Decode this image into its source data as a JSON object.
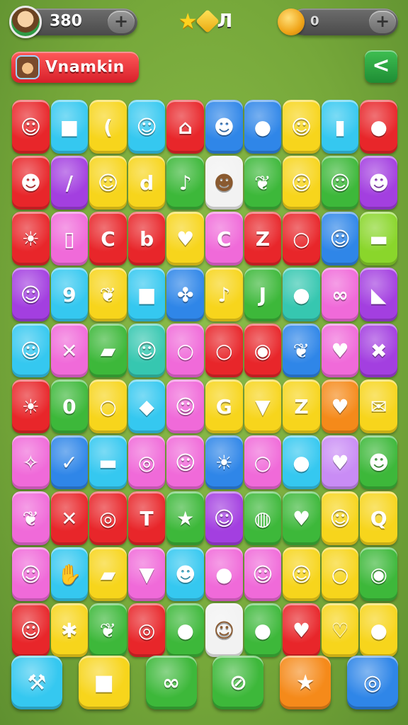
{
  "hud": {
    "coins": "380",
    "plus_label": "+",
    "gems": "0",
    "gem_plus_label": "+",
    "title_note": "Л"
  },
  "banner": {
    "label": "Vnamkin"
  },
  "back_label": "<",
  "colors": {
    "red": "#e8262a",
    "cyan": "#35c8f0",
    "yellow": "#f7d51c",
    "blue": "#2f86e8",
    "purple": "#a33fe0",
    "pink": "#f06ad9",
    "green": "#3db83a",
    "lime": "#8ad62b",
    "orange": "#f58a1a",
    "white": "#f2f2f2",
    "violet": "#c98cf5",
    "teal": "#36c7b0"
  },
  "board": {
    "rows": [
      [
        {
          "c": "red",
          "i": "gnome-icon",
          "g": "☺"
        },
        {
          "c": "cyan",
          "i": "cube-icon",
          "g": "■"
        },
        {
          "c": "yellow",
          "i": "banana-icon",
          "g": "("
        },
        {
          "c": "cyan",
          "i": "smiley-icon",
          "g": "☺"
        },
        {
          "c": "red",
          "i": "house-icon",
          "g": "⌂"
        },
        {
          "c": "blue",
          "i": "monkey-icon",
          "g": "☻"
        },
        {
          "c": "blue",
          "i": "blob-icon",
          "g": "●"
        },
        {
          "c": "yellow",
          "i": "frog-icon",
          "g": "☺"
        },
        {
          "c": "cyan",
          "i": "block-icon",
          "g": "▮"
        },
        {
          "c": "red",
          "i": "fruit-icon",
          "g": "●"
        }
      ],
      [
        {
          "c": "red",
          "i": "monkey-icon",
          "g": "☻"
        },
        {
          "c": "purple",
          "i": "stick-icon",
          "g": "/"
        },
        {
          "c": "yellow",
          "i": "gnome-icon",
          "g": "☺"
        },
        {
          "c": "yellow",
          "i": "letter-d-icon",
          "g": "d"
        },
        {
          "c": "green",
          "i": "bird-icon",
          "g": "♪"
        },
        {
          "c": "white",
          "i": "monkey-icon",
          "g": "☻"
        },
        {
          "c": "green",
          "i": "leaf-icon",
          "g": "❦"
        },
        {
          "c": "yellow",
          "i": "cat-icon",
          "g": "☺"
        },
        {
          "c": "green",
          "i": "cat-icon",
          "g": "☺"
        },
        {
          "c": "purple",
          "i": "bear-icon",
          "g": "☻"
        }
      ],
      [
        {
          "c": "red",
          "i": "lion-icon",
          "g": "☀"
        },
        {
          "c": "pink",
          "i": "bandage-icon",
          "g": "▯"
        },
        {
          "c": "red",
          "i": "letter-c-icon",
          "g": "C"
        },
        {
          "c": "red",
          "i": "letter-b-icon",
          "g": "b"
        },
        {
          "c": "yellow",
          "i": "heart-icon",
          "g": "♥"
        },
        {
          "c": "pink",
          "i": "letter-c-icon",
          "g": "C"
        },
        {
          "c": "red",
          "i": "letter-z-icon",
          "g": "Z"
        },
        {
          "c": "red",
          "i": "ring-icon",
          "g": "○"
        },
        {
          "c": "blue",
          "i": "alien-icon",
          "g": "☺"
        },
        {
          "c": "lime",
          "i": "candy-icon",
          "g": "▬"
        }
      ],
      [
        {
          "c": "purple",
          "i": "gnome-icon",
          "g": "☺"
        },
        {
          "c": "cyan",
          "i": "number-9-icon",
          "g": "9"
        },
        {
          "c": "yellow",
          "i": "leaf-icon",
          "g": "❦"
        },
        {
          "c": "cyan",
          "i": "cube-icon",
          "g": "■"
        },
        {
          "c": "blue",
          "i": "puzzle-icon",
          "g": "✤"
        },
        {
          "c": "yellow",
          "i": "note-icon",
          "g": "♪"
        },
        {
          "c": "green",
          "i": "letter-j-icon",
          "g": "J"
        },
        {
          "c": "teal",
          "i": "fish-icon",
          "g": "●"
        },
        {
          "c": "pink",
          "i": "pretzel-icon",
          "g": "∞"
        },
        {
          "c": "purple",
          "i": "flag-icon",
          "g": "◣"
        }
      ],
      [
        {
          "c": "cyan",
          "i": "sun-icon",
          "g": "☺"
        },
        {
          "c": "pink",
          "i": "cross-icon",
          "g": "✕"
        },
        {
          "c": "green",
          "i": "eraser-icon",
          "g": "▰"
        },
        {
          "c": "teal",
          "i": "frog-icon",
          "g": "☺"
        },
        {
          "c": "pink",
          "i": "balloon-icon",
          "g": "○"
        },
        {
          "c": "red",
          "i": "balloon-icon",
          "g": "○"
        },
        {
          "c": "red",
          "i": "lips-icon",
          "g": "◉"
        },
        {
          "c": "blue",
          "i": "leaf-icon",
          "g": "❦"
        },
        {
          "c": "pink",
          "i": "heart-icon",
          "g": "♥"
        },
        {
          "c": "purple",
          "i": "box-icon",
          "g": "✖"
        }
      ],
      [
        {
          "c": "red",
          "i": "sun-icon",
          "g": "☀"
        },
        {
          "c": "green",
          "i": "number-0-icon",
          "g": "0"
        },
        {
          "c": "yellow",
          "i": "balloon-icon",
          "g": "○"
        },
        {
          "c": "cyan",
          "i": "cake-icon",
          "g": "◆"
        },
        {
          "c": "pink",
          "i": "blob-icon",
          "g": "☺"
        },
        {
          "c": "yellow",
          "i": "letter-g-icon",
          "g": "G"
        },
        {
          "c": "yellow",
          "i": "ice-cream-icon",
          "g": "▼"
        },
        {
          "c": "yellow",
          "i": "letter-z-icon",
          "g": "Z"
        },
        {
          "c": "orange",
          "i": "heart-icon",
          "g": "♥"
        },
        {
          "c": "yellow",
          "i": "envelope-icon",
          "g": "✉"
        }
      ],
      [
        {
          "c": "pink",
          "i": "unicorn-icon",
          "g": "✧"
        },
        {
          "c": "blue",
          "i": "check-icon",
          "g": "✓"
        },
        {
          "c": "cyan",
          "i": "battery-icon",
          "g": "▬"
        },
        {
          "c": "pink",
          "i": "clock-icon",
          "g": "◎"
        },
        {
          "c": "pink",
          "i": "gnome-icon",
          "g": "☺"
        },
        {
          "c": "blue",
          "i": "sun-icon",
          "g": "☀"
        },
        {
          "c": "pink",
          "i": "ring-icon",
          "g": "○"
        },
        {
          "c": "cyan",
          "i": "lemon-icon",
          "g": "●"
        },
        {
          "c": "violet",
          "i": "heart-icon",
          "g": "♥"
        },
        {
          "c": "green",
          "i": "bear-icon",
          "g": "☻"
        }
      ],
      [
        {
          "c": "pink",
          "i": "dragon-icon",
          "g": "❦"
        },
        {
          "c": "red",
          "i": "cross-icon",
          "g": "✕"
        },
        {
          "c": "red",
          "i": "clock-icon",
          "g": "◎"
        },
        {
          "c": "red",
          "i": "hammer-icon",
          "g": "T"
        },
        {
          "c": "green",
          "i": "star-icon",
          "g": "★"
        },
        {
          "c": "purple",
          "i": "bird-icon",
          "g": "☺"
        },
        {
          "c": "green",
          "i": "speech-icon",
          "g": "◍"
        },
        {
          "c": "green",
          "i": "heart-icon",
          "g": "♥"
        },
        {
          "c": "yellow",
          "i": "frog-icon",
          "g": "☺"
        },
        {
          "c": "yellow",
          "i": "letter-q-icon",
          "g": "Q"
        }
      ],
      [
        {
          "c": "pink",
          "i": "smiley-icon",
          "g": "☺"
        },
        {
          "c": "cyan",
          "i": "hand-icon",
          "g": "✋"
        },
        {
          "c": "yellow",
          "i": "crayon-icon",
          "g": "▰"
        },
        {
          "c": "pink",
          "i": "bag-icon",
          "g": "▼"
        },
        {
          "c": "cyan",
          "i": "bear-icon",
          "g": "☻"
        },
        {
          "c": "pink",
          "i": "cherry-icon",
          "g": "●"
        },
        {
          "c": "pink",
          "i": "frog-icon",
          "g": "☺"
        },
        {
          "c": "yellow",
          "i": "cat-icon",
          "g": "☺"
        },
        {
          "c": "yellow",
          "i": "balloon-icon",
          "g": "○"
        },
        {
          "c": "green",
          "i": "eye-icon",
          "g": "◉"
        }
      ],
      [
        {
          "c": "red",
          "i": "gnome-icon",
          "g": "☺"
        },
        {
          "c": "yellow",
          "i": "bug-icon",
          "g": "✱"
        },
        {
          "c": "green",
          "i": "leaf-icon",
          "g": "❦"
        },
        {
          "c": "red",
          "i": "swirl-icon",
          "g": "◎"
        },
        {
          "c": "green",
          "i": "bean-icon",
          "g": "●"
        },
        {
          "c": "white",
          "i": "cat-icon",
          "g": "☺"
        },
        {
          "c": "green",
          "i": "plum-icon",
          "g": "●"
        },
        {
          "c": "red",
          "i": "heart-icon",
          "g": "♥"
        },
        {
          "c": "yellow",
          "i": "heart-icon",
          "g": "♡"
        },
        {
          "c": "yellow",
          "i": "pumpkin-icon",
          "g": "●"
        }
      ]
    ]
  },
  "toolbar": [
    {
      "c": "cyan",
      "i": "hammer-icon",
      "g": "⚒"
    },
    {
      "c": "yellow",
      "i": "square-icon",
      "g": "■"
    },
    {
      "c": "green",
      "i": "swap-icon",
      "g": "∞"
    },
    {
      "c": "green",
      "i": "no-entry-icon",
      "g": "⊘"
    },
    {
      "c": "orange",
      "i": "star-icon",
      "g": "★"
    },
    {
      "c": "blue",
      "i": "target-icon",
      "g": "◎"
    }
  ]
}
